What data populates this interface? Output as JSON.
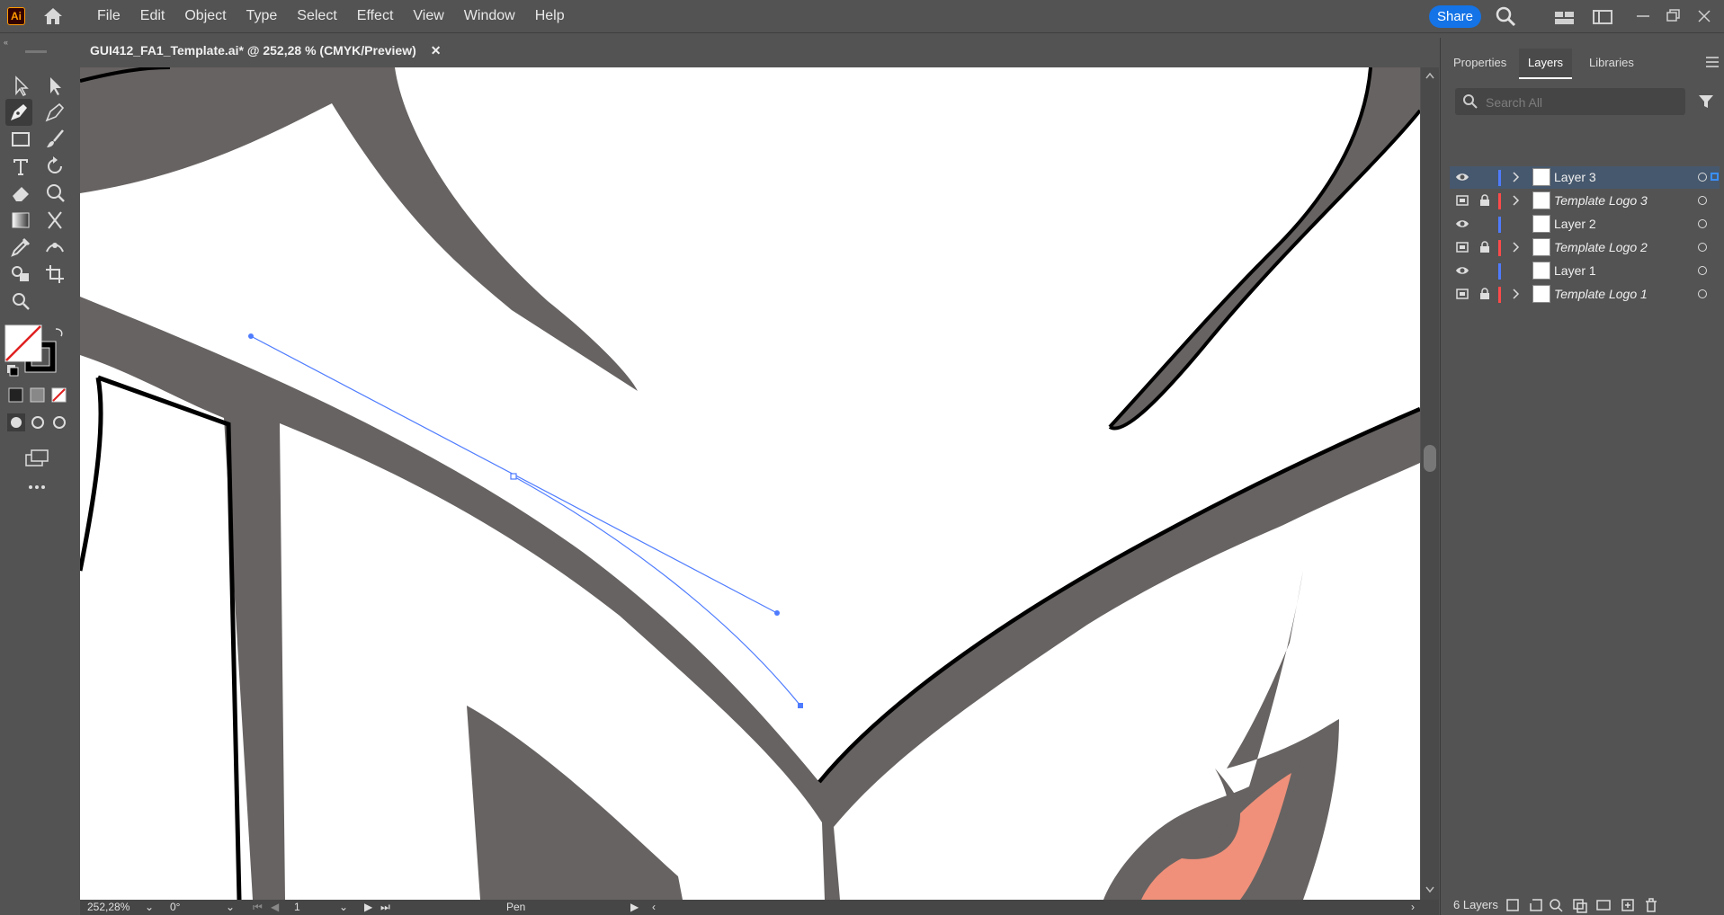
{
  "app": {
    "logo_text": "Ai"
  },
  "menu": [
    "File",
    "Edit",
    "Object",
    "Type",
    "Select",
    "Effect",
    "View",
    "Window",
    "Help"
  ],
  "share_label": "Share",
  "document_tab": {
    "title": "GUI412_FA1_Template.ai* @ 252,28 % (CMYK/Preview)",
    "close": "✕"
  },
  "status": {
    "zoom": "252,28%",
    "rotation": "0°",
    "artboard": "1",
    "tool": "Pen"
  },
  "panel": {
    "tabs": [
      "Properties",
      "Layers",
      "Libraries"
    ],
    "active_tab": "Layers",
    "search_placeholder": "Search All",
    "layers": [
      {
        "name": "Layer 3",
        "color": "#4f7cff",
        "template": false,
        "locked": false,
        "expandable": true,
        "selected": true
      },
      {
        "name": "Template Logo 3",
        "color": "#ff4a4a",
        "template": true,
        "locked": true,
        "expandable": true,
        "selected": false
      },
      {
        "name": "Layer 2",
        "color": "#4f7cff",
        "template": false,
        "locked": false,
        "expandable": false,
        "selected": false
      },
      {
        "name": "Template Logo 2",
        "color": "#ff4a4a",
        "template": true,
        "locked": true,
        "expandable": true,
        "selected": false
      },
      {
        "name": "Layer 1",
        "color": "#4f7cff",
        "template": false,
        "locked": false,
        "expandable": false,
        "selected": false
      },
      {
        "name": "Template Logo 1",
        "color": "#ff4a4a",
        "template": true,
        "locked": true,
        "expandable": true,
        "selected": false
      }
    ],
    "footer_count": "6 Layers"
  },
  "colors": {
    "accent": "#1473e6",
    "path": "#4f7cff",
    "template_fill": "#676362",
    "eye_fill": "#f0907a"
  }
}
